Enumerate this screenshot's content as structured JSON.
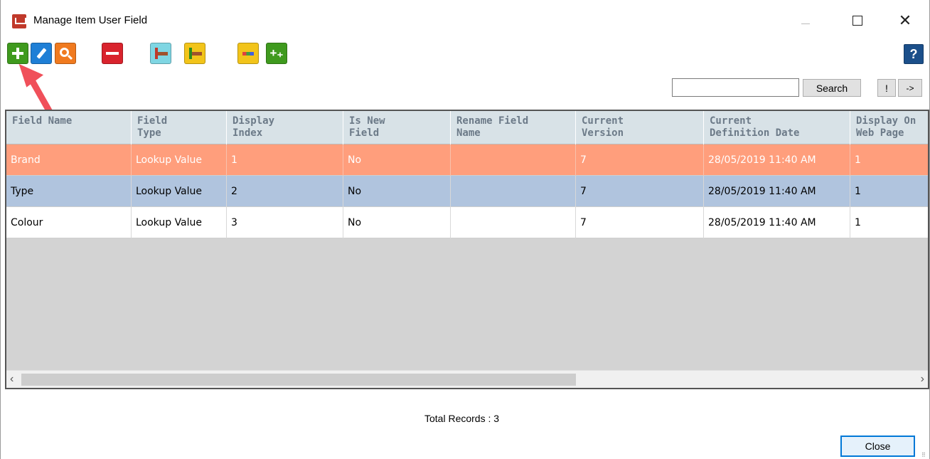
{
  "window": {
    "title": "Manage Item User Field",
    "controls": {
      "close_glyph": "✕"
    }
  },
  "toolbar": {
    "buttons": [
      {
        "name": "add-icon"
      },
      {
        "name": "edit-icon"
      },
      {
        "name": "view-icon"
      },
      {
        "name": "delete-icon"
      },
      {
        "name": "move-down-icon"
      },
      {
        "name": "move-up-icon"
      },
      {
        "name": "fields-icon"
      },
      {
        "name": "add-field-icon"
      }
    ],
    "add_field_glyph": "+₊",
    "help_label": "?"
  },
  "search": {
    "value": "",
    "button_label": "Search",
    "bang_label": "!",
    "go_label": "->"
  },
  "grid": {
    "columns": [
      [
        "Field Name",
        ""
      ],
      [
        "Field",
        "Type"
      ],
      [
        "Display",
        "Index"
      ],
      [
        "Is New",
        "Field"
      ],
      [
        "Rename Field",
        "Name"
      ],
      [
        "Current",
        "Version"
      ],
      [
        "Current",
        "Definition Date"
      ],
      [
        "Display On",
        "Web Page"
      ]
    ],
    "rows": [
      [
        "Brand",
        "Lookup Value",
        "1",
        "No",
        "",
        "7",
        "28/05/2019 11:40 AM",
        "1"
      ],
      [
        "Type",
        "Lookup Value",
        "2",
        "No",
        "",
        "7",
        "28/05/2019 11:40 AM",
        "1"
      ],
      [
        "Colour",
        "Lookup Value",
        "3",
        "No",
        "",
        "7",
        "28/05/2019 11:40 AM",
        "1"
      ]
    ],
    "selected_row": 0,
    "colors": {
      "selected": "#ff9e7c",
      "alternate": "#b0c4de",
      "normal": "#ffffff",
      "header": "#d8e2e7"
    }
  },
  "footer": {
    "total_records": "Total Records : 3",
    "close_label": "Close"
  },
  "annotation": {
    "arrow_color": "#f0505a"
  }
}
